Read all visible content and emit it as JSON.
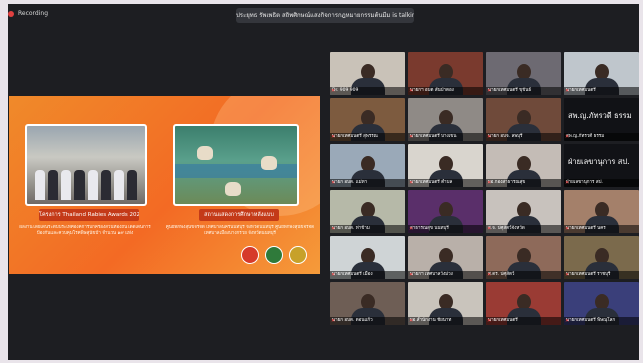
{
  "header": {
    "recording_label": "Recording",
    "talking": "ประยุทธ รัพเพธิต สถิพศิกษณ์แสงกิจการกฎหมายกรรมต้นมีม is talking..."
  },
  "shared_screen": {
    "left_caption": "โครงการ Thailand Rabies Awards 2021",
    "right_caption": "สถานแสดงการศึกษาหลังแบบ",
    "left_desc": "ผลงานโดยเด่นระดับประเทศองค์การปกครองส่วนท้องถิ่นโดดเด่นการป้องกันและควบคุมโรคพิษสุนัขบ้า จำนวน ๑๙ แห่ง",
    "right_desc": "ศูนย์พักพิงสุนัขจรจัด เทศบาลนครนนทบุรี จังหวัดนนทบุรี ศูนย์พักพิงสุนัขจรจัด เทศบาลเมืองบางกรวย จังหวัดนนทบุรี"
  },
  "participants": [
    {
      "name": "Dr. 909 909",
      "text": false,
      "bg": "#c9c2b8"
    },
    {
      "name": "นายกฯ อบต สันป่าตอง",
      "text": false,
      "bg": "#7a3a2e"
    },
    {
      "name": "นายกเทศมนตรี ขุขันธ์",
      "text": false,
      "bg": "#6d6a72"
    },
    {
      "name": "นายกเทศมนตรี",
      "text": false,
      "bg": "#bfc6cc"
    },
    {
      "name": "นายกเทศมนตรี สุพรรณ",
      "text": false,
      "bg": "#7d5b3f"
    },
    {
      "name": "นายกเทศมนตรี บางเขน",
      "text": false,
      "bg": "#8f8a86"
    },
    {
      "name": "นายก อบจ. ลพบุรี",
      "text": false,
      "bg": "#6f4a3a"
    },
    {
      "name": "สพ.ญ.ภัทรวดี ธรรม",
      "text": true,
      "bg": "#111216"
    },
    {
      "name": "นายก อบต. แม่ทา",
      "text": false,
      "bg": "#9aa9b8"
    },
    {
      "name": "นายกเทศมนตรี ตำบล",
      "text": false,
      "bg": "#d9d5ce"
    },
    {
      "name": "ผอ.กองสาธารณสุข",
      "text": false,
      "bg": "#c4bcb6"
    },
    {
      "name": "ฝ่ายเลขานุการ สป.",
      "text": true,
      "bg": "#111216"
    },
    {
      "name": "นายก อบต. ท่าข้าม",
      "text": false,
      "bg": "#b6b9a8"
    },
    {
      "name": "สาธารณสุข นนทบุรี",
      "text": false,
      "bg": "#5a2f6a"
    },
    {
      "name": "ส.จ. ปศุสัตว์จังหวัด",
      "text": false,
      "bg": "#c8c2bd"
    },
    {
      "name": "นายกเทศมนตรี นคร",
      "text": false,
      "bg": "#a4806a"
    },
    {
      "name": "นายกเทศมนตรี เมือง",
      "text": false,
      "bg": "#cfd4d6"
    },
    {
      "name": "นายกฯ เทศบาลวังม่วง",
      "text": false,
      "bg": "#b9b0a9"
    },
    {
      "name": "ศ.ดร. ปศุสัตว์",
      "text": false,
      "bg": "#8e6a5a"
    },
    {
      "name": "นายกเทศมนตรี ราชบุรี",
      "text": false,
      "bg": "#7b6a4c"
    },
    {
      "name": "นายก อบต. ดอนแก้ว",
      "text": false,
      "bg": "#6e5e55"
    },
    {
      "name": "ผอ.สำนักงาน ชัยนาท",
      "text": false,
      "bg": "#c9c4bc"
    },
    {
      "name": "นายกเทศมนตรี",
      "text": false,
      "bg": "#9a3b34"
    },
    {
      "name": "นายกเทศมนตรี พิษณุโลก",
      "text": false,
      "bg": "#3a3f7a"
    }
  ]
}
